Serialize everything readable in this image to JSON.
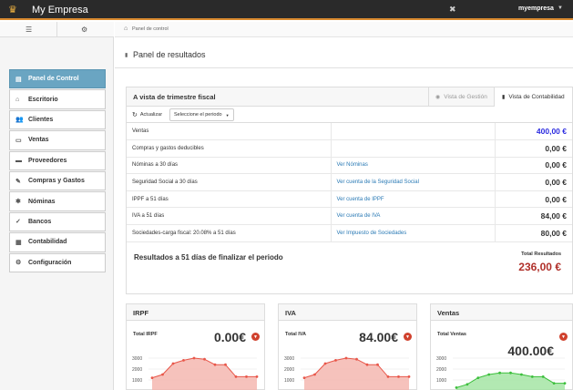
{
  "app": {
    "title": "My Empresa",
    "user": "myempresa"
  },
  "colors": {
    "accent": "#6aa5c2",
    "topbar": "#2a2a2a",
    "danger": "#b0302a",
    "link": "#2a7ab5"
  },
  "breadcrumb": "Panel de control",
  "page_title": "Panel de resultados",
  "sidebar": {
    "items": [
      {
        "label": "Panel de Control",
        "icon": "dashboard-icon"
      },
      {
        "label": "Escritorio",
        "icon": "home-icon"
      },
      {
        "label": "Clientes",
        "icon": "users-icon"
      },
      {
        "label": "Ventas",
        "icon": "cash-icon"
      },
      {
        "label": "Proveedores",
        "icon": "truck-icon"
      },
      {
        "label": "Compras y Gastos",
        "icon": "pencil-icon"
      },
      {
        "label": "Nóminas",
        "icon": "gear-icon"
      },
      {
        "label": "Bancos",
        "icon": "bank-icon"
      },
      {
        "label": "Contabilidad",
        "icon": "book-icon"
      },
      {
        "label": "Configuración",
        "icon": "cog-icon"
      }
    ]
  },
  "panel": {
    "title": "A vista de trimestre fiscal",
    "tab_gestion": "Vista de Gestión",
    "tab_contabilidad": "Vista de Contabilidad",
    "refresh_label": "Actualizar",
    "period_label": "Seleccione el periodo",
    "rows": [
      {
        "label": "Ventas",
        "link": "",
        "value": "400,00 €"
      },
      {
        "label": "Compras y gastos deducibles",
        "link": "",
        "value": "0,00 €"
      },
      {
        "label": "Nóminas a 30 días",
        "link": "Ver Nóminas",
        "value": "0,00 €"
      },
      {
        "label": "Seguridad Social a 30 días",
        "link": "Ver cuenta de la Seguridad Social",
        "value": "0,00 €"
      },
      {
        "label": "IPPF a 51 días",
        "link": "Ver cuenta de IPPF",
        "value": "0,00 €"
      },
      {
        "label": "IVA a 51 días",
        "link": "Ver cuenta de IVA",
        "value": "84,00 €"
      },
      {
        "label": "Sociedades-carga fiscal: 20.08% a 51 días",
        "link": "Ver Impuesto de Sociedades",
        "value": "80,00 €"
      }
    ],
    "summary_text": "Resultados a 51 días de finalizar el periodo",
    "total_label": "Total Resultados",
    "total_value": "236,00 €"
  },
  "cards": [
    {
      "title": "IRPF",
      "label": "Total IRPF",
      "value": "0.00€",
      "color": "#e8574a",
      "fill": "#f4b3ab",
      "yticks": [
        "3000",
        "2000",
        "1000"
      ],
      "points": [
        1200,
        1500,
        2500,
        2800,
        3000,
        2900,
        2400,
        2400,
        1300,
        1300,
        1300
      ]
    },
    {
      "title": "IVA",
      "label": "Total IVA",
      "value": "84.00€",
      "color": "#e8574a",
      "fill": "#f4b3ab",
      "yticks": [
        "3000",
        "2000",
        "1000"
      ],
      "points": [
        1200,
        1500,
        2500,
        2800,
        3000,
        2900,
        2400,
        2400,
        1300,
        1300,
        1300
      ]
    },
    {
      "title": "Ventas",
      "label": "Total Ventas",
      "value": "400.00€",
      "color": "#3cbf3c",
      "fill": "#9fe39f",
      "yticks": [
        "3000",
        "2000",
        "1000"
      ],
      "points": [
        300,
        600,
        1200,
        1500,
        1650,
        1650,
        1500,
        1300,
        1300,
        700,
        700
      ]
    }
  ]
}
